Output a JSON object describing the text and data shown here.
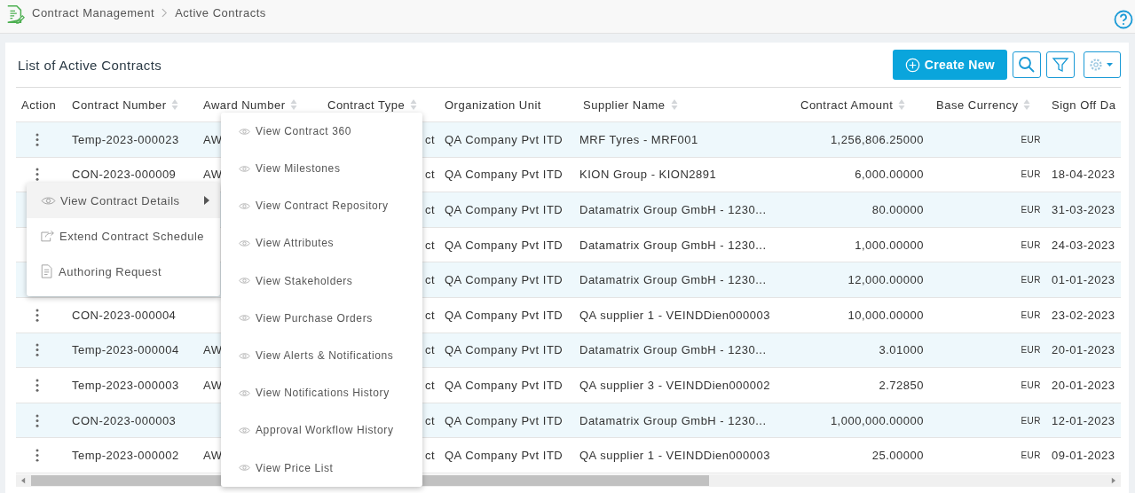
{
  "breadcrumb": [
    "Contract Management",
    "Active Contracts"
  ],
  "title": "List of Active Contracts",
  "toolbar": {
    "create_label": "Create New"
  },
  "table": {
    "columns": [
      {
        "label": "Action",
        "sortable": false
      },
      {
        "label": "Contract Number",
        "sortable": true
      },
      {
        "label": "Award Number",
        "sortable": true
      },
      {
        "label": "Contract Type",
        "sortable": true
      },
      {
        "label": "Organization Unit",
        "sortable": false
      },
      {
        "label": "Supplier Name",
        "sortable": true
      },
      {
        "label": "Contract Amount",
        "sortable": true
      },
      {
        "label": "Base Currency",
        "sortable": true
      },
      {
        "label": "Sign Off Da"
      }
    ],
    "rows": [
      {
        "menu_button": true,
        "contract_number": "Temp-2023-000023",
        "award_number": "AW",
        "contract_type": "ct",
        "organization_unit": "QA Company Pvt ITD",
        "supplier_name": "MRF Tyres - MRF001",
        "contract_amount": "1,256,806.25000",
        "base_currency": "EUR"
      },
      {
        "menu_button": true,
        "contract_number": "CON-2023-000009",
        "award_number": "AW",
        "contract_type": "ct",
        "organization_unit": "QA Company Pvt ITD",
        "supplier_name": "KION Group - KION2891",
        "contract_amount": "6,000.00000",
        "base_currency": "EUR",
        "sign_off_date": "18-04-2023"
      },
      {
        "contract_type": "ct",
        "organization_unit": "QA Company Pvt ITD",
        "supplier_name": "Datamatrix Group GmbH - 1230...",
        "contract_amount": "80.00000",
        "base_currency": "EUR",
        "sign_off_date": "31-03-2023"
      },
      {
        "contract_type": "ct",
        "organization_unit": "QA Company Pvt ITD",
        "supplier_name": "Datamatrix Group GmbH - 1230...",
        "contract_amount": "1,000.00000",
        "base_currency": "EUR",
        "sign_off_date": "24-03-2023"
      },
      {
        "contract_type": "ct",
        "organization_unit": "QA Company Pvt ITD",
        "supplier_name": "Datamatrix Group GmbH - 1230...",
        "contract_amount": "12,000.00000",
        "base_currency": "EUR",
        "sign_off_date": "01-01-2023"
      },
      {
        "menu_button": true,
        "contract_number": "CON-2023-000004",
        "contract_type": "ct",
        "organization_unit": "QA Company Pvt ITD",
        "supplier_name": "QA supplier 1 - VEINDDien000003",
        "contract_amount": "10,000.00000",
        "base_currency": "EUR",
        "sign_off_date": "23-02-2023"
      },
      {
        "menu_button": true,
        "contract_number": "Temp-2023-000004",
        "award_number": "AW",
        "contract_type": "ct",
        "organization_unit": "QA Company Pvt ITD",
        "supplier_name": "Datamatrix Group GmbH - 1230...",
        "contract_amount": "3.01000",
        "base_currency": "EUR",
        "sign_off_date": "20-01-2023"
      },
      {
        "menu_button": true,
        "contract_number": "Temp-2023-000003",
        "award_number": "AW",
        "contract_type": "ct",
        "organization_unit": "QA Company Pvt ITD",
        "supplier_name": "QA supplier 3 - VEINDDien000002",
        "contract_amount": "2.72850",
        "base_currency": "EUR",
        "sign_off_date": "20-01-2023"
      },
      {
        "menu_button": true,
        "contract_number": "CON-2023-000003",
        "contract_type": "ct",
        "organization_unit": "QA Company Pvt ITD",
        "supplier_name": "Datamatrix Group GmbH - 1230...",
        "contract_amount": "1,000,000.00000",
        "base_currency": "EUR",
        "sign_off_date": "12-01-2023"
      },
      {
        "menu_button": true,
        "contract_number": "Temp-2023-000002",
        "award_number": "AW",
        "contract_type": "ct",
        "organization_unit": "QA Company Pvt ITD",
        "supplier_name": "QA supplier 1 - VEINDDien000003",
        "contract_amount": "25.00000",
        "base_currency": "EUR",
        "sign_off_date": "09-01-2023"
      }
    ]
  },
  "action_menu": {
    "items": [
      {
        "label": "View Contract Details",
        "kind": "view",
        "has_submenu": true,
        "selected": true
      },
      {
        "label": "Extend Contract Schedule",
        "kind": "extend",
        "has_submenu": false,
        "selected": false
      },
      {
        "label": "Authoring Request",
        "kind": "document",
        "has_submenu": false,
        "selected": false
      }
    ]
  },
  "submenu": {
    "items": [
      "View Contract 360",
      "View Milestones",
      "View Contract Repository",
      "View Attributes",
      "View Stakeholders",
      "View Purchase Orders",
      "View Alerts & Notifications",
      "View Notifications History",
      "Approval Workflow History",
      "View Price List"
    ]
  }
}
